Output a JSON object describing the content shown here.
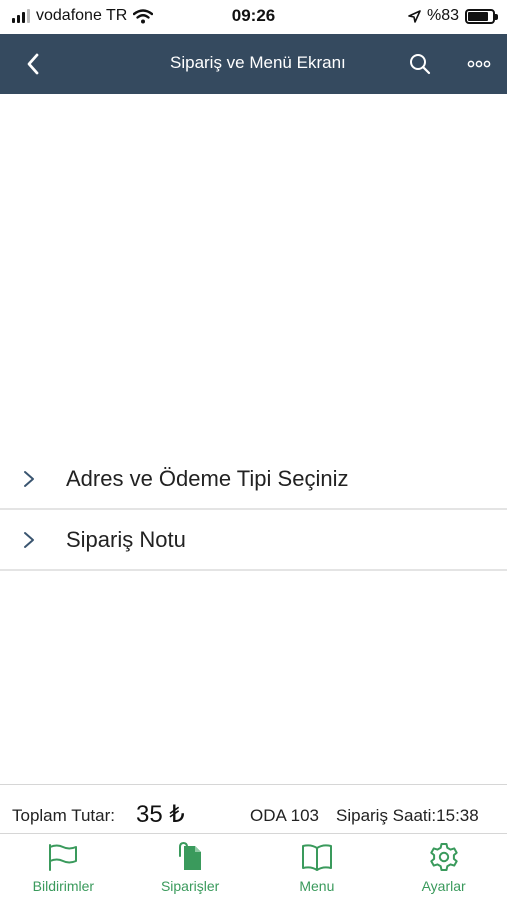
{
  "status_bar": {
    "carrier": "vodafone TR",
    "time": "09:26",
    "battery": "%83",
    "battery_level": 0.83,
    "icons": [
      "signal-icon",
      "wifi-icon",
      "location-icon",
      "battery-icon"
    ]
  },
  "nav": {
    "title": "Sipariş ve Menü Ekranı",
    "background": "#354a5f",
    "icons": [
      "back-chevron-icon",
      "search-icon",
      "more-icon"
    ]
  },
  "list": {
    "items": [
      {
        "label": "Adres ve Ödeme Tipi Seçiniz",
        "icon": "chevron-right-icon"
      },
      {
        "label": "Sipariş Notu",
        "icon": "chevron-right-icon"
      }
    ]
  },
  "summary": {
    "total_label": "Toplam Tutar:",
    "total_amount": "35 ₺",
    "room": "ODA 103",
    "order_time": "Sipariş Saati:15:38"
  },
  "tabs": {
    "accent": "#3a9a5c",
    "items": [
      {
        "label": "Bildirimler",
        "icon": "flag-icon"
      },
      {
        "label": "Siparişler",
        "icon": "order-icon"
      },
      {
        "label": "Menu",
        "icon": "book-icon"
      },
      {
        "label": "Ayarlar",
        "icon": "gear-icon"
      }
    ]
  }
}
